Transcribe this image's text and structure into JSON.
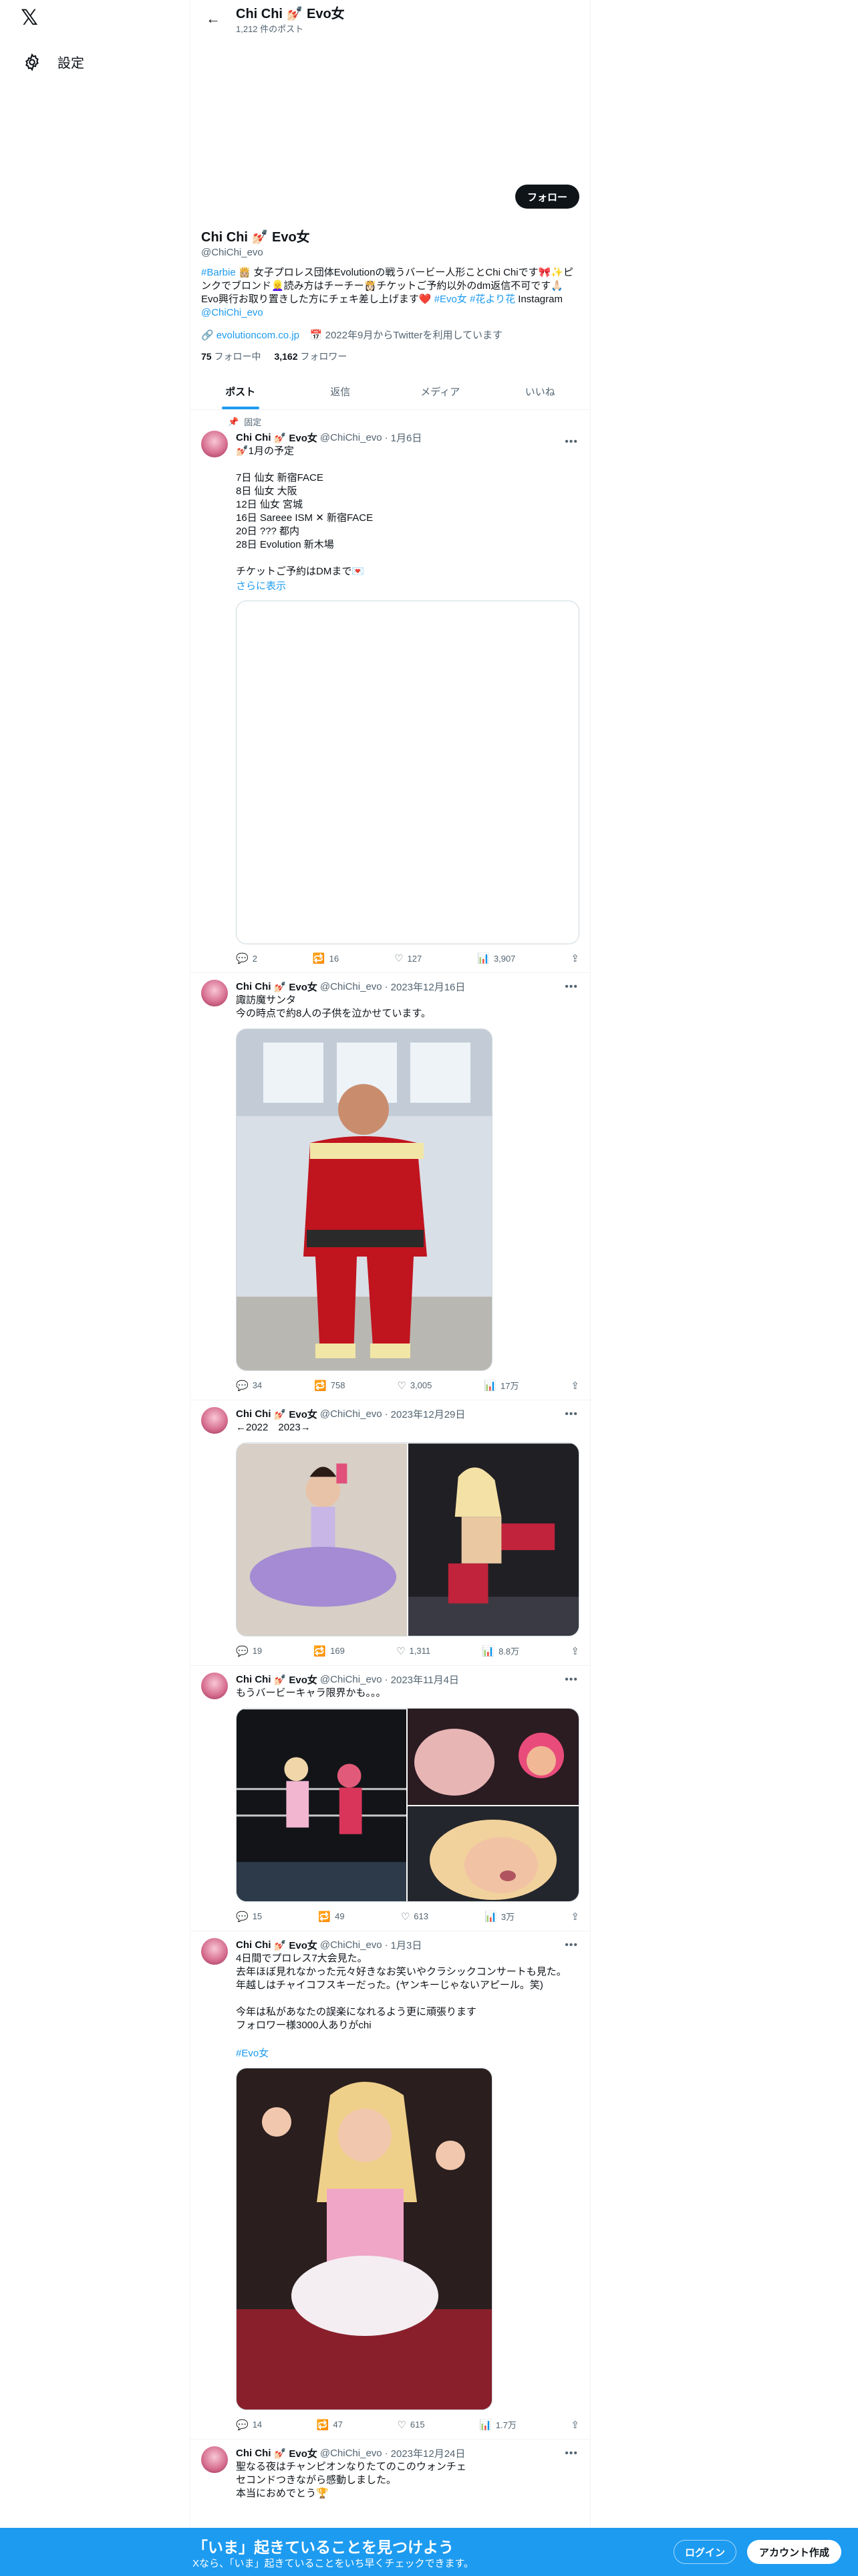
{
  "nav": {
    "settings_label": "設定"
  },
  "header": {
    "name": "Chi Chi 💅🏻 Evo女",
    "post_count": "1,212 件のポスト"
  },
  "profile": {
    "follow_label": "フォロー",
    "name": "Chi Chi 💅🏻 Evo女",
    "handle": "@ChiChi_evo",
    "bio_tag1": "#Barbie",
    "bio_text1": " 👸🏼 女子プロレス団体Evolutionの戦うバービー人形ことChi Chiです🎀✨ピンクでブロンド👱‍♀️読み方はチーチー👸🏻チケットご予約以外のdm返信不可です🙏🏻Evo興行お取り置きした方にチェキ差し上げます❤️ ",
    "bio_tag2": "#Evo女",
    "bio_tag3": "#花より花",
    "bio_text2": " Instagram ",
    "bio_link": "@ChiChi_evo",
    "website": "evolutioncom.co.jp",
    "joined": "2022年9月からTwitterを利用しています",
    "following_count": "75",
    "following_label": "フォロー中",
    "followers_count": "3,162",
    "followers_label": "フォロワー"
  },
  "tabs": [
    "ポスト",
    "返信",
    "メディア",
    "いいね"
  ],
  "pinned_label": "固定",
  "tweets": [
    {
      "name": "Chi Chi",
      "badge": "💅🏻 Evo女",
      "handle": "@ChiChi_evo",
      "date": "1月6日",
      "text": "💅🏻1月の予定\n\n7日 仙女 新宿FACE\n8日 仙女 大阪\n12日 仙女 宮城\n16日 Sareee ISM ✕ 新宿FACE\n20日 ??? 都内\n28日 Evolution 新木場\n\nチケットご予約はDMまで💌",
      "show_more": "さらに表示",
      "replies": "2",
      "retweets": "16",
      "likes": "127",
      "views": "3,907"
    },
    {
      "name": "Chi Chi",
      "badge": "💅🏻 Evo女",
      "handle": "@ChiChi_evo",
      "date": "2023年12月16日",
      "text": "諏訪魔サンタ\n今の時点で約8人の子供を泣かせています。",
      "replies": "34",
      "retweets": "758",
      "likes": "3,005",
      "views": "17万"
    },
    {
      "name": "Chi Chi",
      "badge": "💅🏻 Evo女",
      "handle": "@ChiChi_evo",
      "date": "2023年12月29日",
      "text": "←2022　2023→",
      "replies": "19",
      "retweets": "169",
      "likes": "1,311",
      "views": "8.8万"
    },
    {
      "name": "Chi Chi",
      "badge": "💅🏻 Evo女",
      "handle": "@ChiChi_evo",
      "date": "2023年11月4日",
      "text": "もうバービーキャラ限界かも。。。",
      "replies": "15",
      "retweets": "49",
      "likes": "613",
      "views": "3万"
    },
    {
      "name": "Chi Chi",
      "badge": "💅🏻 Evo女",
      "handle": "@ChiChi_evo",
      "date": "1月3日",
      "text": "4日間でプロレス7大会見た。\n去年ほぼ見れなかった元々好きなお笑いやクラシックコンサートも見た。\n年越しはチャイコフスキーだった。(ヤンキーじゃないアピール。笑)\n\n今年は私があなたの誤楽になれるよう更に頑張ります\nフォロワー様3000人ありがchi",
      "tag": "#Evo女",
      "replies": "14",
      "retweets": "47",
      "likes": "615",
      "views": "1.7万"
    },
    {
      "name": "Chi Chi",
      "badge": "💅🏻 Evo女",
      "handle": "@ChiChi_evo",
      "date": "2023年12月24日",
      "text": "聖なる夜はチャンピオンなりたてのこのウォンチェ\nセコンドつきながら感動しました。\n本当におめでとう🏆"
    }
  ],
  "bottom": {
    "title": "「いま」起きていることを見つけよう",
    "subtitle": "Xなら、「いま」起きていることをいち早くチェックできます。",
    "login": "ログイン",
    "signup": "アカウント作成"
  }
}
